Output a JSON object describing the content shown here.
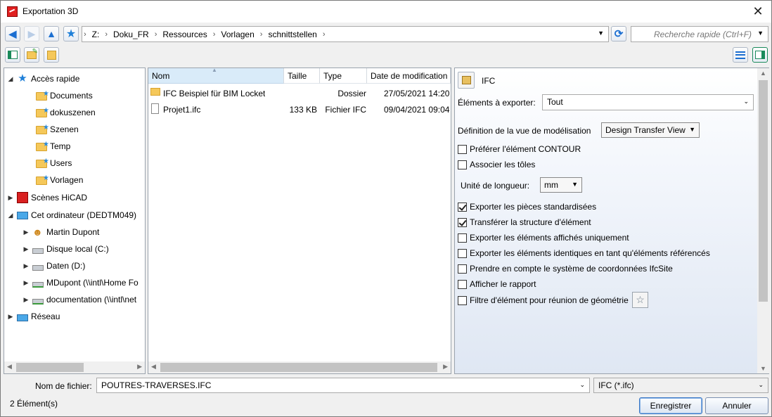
{
  "window": {
    "title": "Exportation 3D"
  },
  "address": {
    "crumbs": [
      "Z:",
      "Doku_FR",
      "Ressources",
      "Vorlagen",
      "schnittstellen"
    ]
  },
  "search": {
    "placeholder": "Recherche rapide (Ctrl+F)"
  },
  "tree": {
    "quick_access": "Accès rapide",
    "quick_items": [
      "Documents",
      "dokuszenen",
      "Szenen",
      "Temp",
      "Users",
      "Vorlagen"
    ],
    "scenes": "Scènes  HiCAD",
    "computer": "Cet ordinateur (DEDTM049)",
    "computer_items": [
      "Martin Dupont",
      "Disque local (C:)",
      "Daten (D:)",
      "MDupont (\\\\intl\\Home Fo",
      "documentation (\\\\intl\\net"
    ],
    "network": "Réseau"
  },
  "files": {
    "columns": [
      "Nom",
      "Taille",
      "Type",
      "Date de modification"
    ],
    "rows": [
      {
        "name": "IFC Beispiel für BIM Locket",
        "size": "",
        "type": "Dossier",
        "date": "27/05/2021 14:20",
        "kind": "folder"
      },
      {
        "name": "Projet1.ifc",
        "size": "133 KB",
        "type": "Fichier IFC",
        "date": "09/04/2021 09:04",
        "kind": "file"
      }
    ]
  },
  "props": {
    "header": "IFC",
    "elements_label": "Éléments à exporter:",
    "elements_value": "Tout",
    "view_label": "Définition de la vue de modélisation",
    "view_value": "Design Transfer View",
    "unit_label": "Unité de longueur:",
    "unit_value": "mm",
    "options": [
      {
        "label": "Préférer l'élément CONTOUR",
        "checked": false
      },
      {
        "label": "Associer les tôles",
        "checked": false
      },
      {
        "label": "Exporter les pièces standardisées",
        "checked": true
      },
      {
        "label": "Transférer la structure d'élément",
        "checked": true
      },
      {
        "label": "Exporter les éléments affichés uniquement",
        "checked": false
      },
      {
        "label": "Exporter les éléments identiques en tant qu'éléments référencés",
        "checked": false
      },
      {
        "label": "Prendre en compte le système de coordonnées IfcSite",
        "checked": false
      },
      {
        "label": "Afficher le rapport",
        "checked": false
      },
      {
        "label": "Filtre d'élément pour réunion de géométrie",
        "checked": false
      }
    ]
  },
  "footer": {
    "filename_label": "Nom de fichier:",
    "filename_value": "POUTRES-TRAVERSES.IFC",
    "filetype_value": "IFC (*.ifc)",
    "status": "2 Élément(s)",
    "save_label": "Enregistrer",
    "cancel_label": "Annuler"
  }
}
